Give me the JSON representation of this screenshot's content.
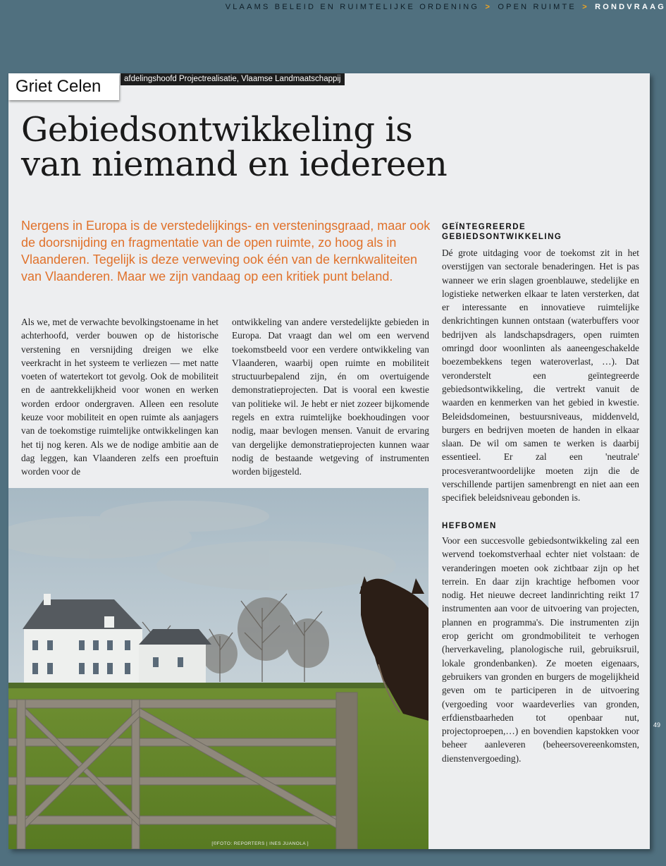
{
  "breadcrumb": {
    "part1": "VLAAMS BELEID EN RUIMTELIJKE ORDENING",
    "part2": "OPEN RUIMTE",
    "current": "RONDVRAAG",
    "separator": ">"
  },
  "author": {
    "name": "Griet Celen",
    "role": "afdelingshoofd Projectrealisatie, Vlaamse Landmaatschappij"
  },
  "article": {
    "title_line1": "Gebiedsontwikkeling is",
    "title_line2": "van niemand en iedereen",
    "lead": "Nergens in Europa is de verstedelijkings- en versteningsgraad, maar ook de doorsnijding en fragmentatie van de open ruimte, zo hoog als in Vlaanderen. Tegelijk is deze verweving ook één van de kernkwaliteiten van Vlaanderen. Maar we zijn vandaag op een kritiek punt beland.",
    "col1": "Als we, met de verwachte bevolkingstoename in het achterhoofd, verder bouwen op de historische verstening en versnijding dreigen we elke veerkracht in het systeem te verliezen — met natte voeten of watertekort tot gevolg. Ook de mobiliteit en de aantrekkelijkheid voor wonen en werken worden erdoor ondergraven. Alleen een resolute keuze voor mobiliteit en open ruimte als aanjagers van de toekomstige ruimtelijke ontwikkelingen kan het tij nog keren. Als we de nodige ambitie aan de dag leggen, kan Vlaanderen zelfs een proeftuin worden voor de",
    "col2": "ontwikkeling van andere verstedelijkte gebieden in Europa. Dat vraagt dan wel om een wervend toekomstbeeld voor een verdere ontwikkeling van Vlaanderen, waarbij open ruimte en mobiliteit structuurbepalend zijn, én om overtuigende demonstratieprojecten. Dat is vooral een kwestie van politieke wil. Je hebt er niet zozeer bijkomende regels en extra ruimtelijke boekhoudingen voor nodig, maar bevlogen mensen. Vanuit de ervaring van dergelijke demonstratieprojecten kunnen waar nodig de bestaande wetgeving of instrumenten worden bijgesteld.",
    "section1_heading": "GEÏNTEGREERDE GEBIEDSONTWIKKELING",
    "section1_text": "Dé grote uitdaging voor de toekomst zit in het overstijgen van sectorale benaderingen. Het is pas wanneer we erin slagen groenblauwe, stedelijke en logistieke netwerken elkaar te laten versterken, dat er interessante en innovatieve ruimtelijke denkrichtingen kunnen ontstaan (waterbuffers voor bedrijven als landschapsdragers, open ruimten omringd door woonlinten als aaneengeschakelde boezembekkens tegen wateroverlast, …). Dat veronderstelt een geïntegreerde gebiedsontwikkeling, die vertrekt vanuit de waarden en kenmerken van het gebied in kwestie. Beleidsdomeinen, bestuursniveaus, middenveld, burgers en bedrijven moeten de handen in elkaar slaan. De wil om samen te werken is daarbij essentieel. Er zal een 'neutrale' procesverantwoordelijke moeten zijn die de verschillende partijen samenbrengt en niet aan een specifiek beleidsniveau gebonden is.",
    "section2_heading": "HEFBOMEN",
    "section2_text": "Voor een succesvolle gebiedsontwikkeling zal een wervend toekomstverhaal echter niet volstaan: de veranderingen moeten ook zichtbaar zijn op het terrein. En daar zijn krachtige hefbomen voor nodig. Het nieuwe decreet landinrichting reikt 17 instrumenten aan voor de uitvoering van projecten, plannen en programma's. Die instrumenten zijn erop gericht om grondmobiliteit te verhogen (herverkaveling, planologische ruil, gebruiksruil, lokale grondenbanken). Ze moeten eigenaars, gebruikers van gronden en burgers de mogelijkheid geven om te participeren in de uitvoering (vergoeding voor waardeverlies van gronden, erfdienstbaarheden tot openbaar nut, projectoproepen,…) en bovendien kapstokken voor beheer aanleveren (beheersovereenkomsten, dienstenvergoeding)."
  },
  "photo": {
    "credit": "[©FOTO: REPORTERS | INES JUANOLA ]"
  },
  "page_number": "49",
  "colors": {
    "background": "#50707f",
    "accent": "#e0712a",
    "chevron": "#f2a61f"
  }
}
